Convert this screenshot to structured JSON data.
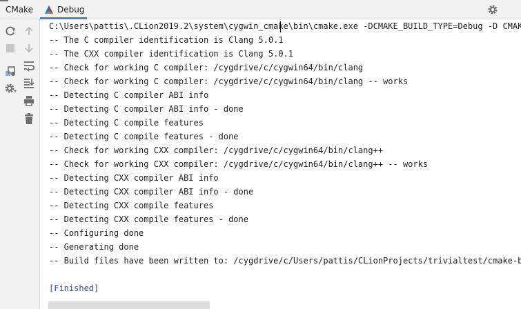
{
  "tabs": [
    {
      "label": "CMake"
    },
    {
      "label": "Debug"
    }
  ],
  "console": {
    "command": "C:\\Users\\pattis\\.CLion2019.2\\system\\cygwin_cmake\\bin\\cmake.exe -DCMAKE_BUILD_TYPE=Debug -D CMAKE_C",
    "lines": [
      "-- The C compiler identification is Clang 5.0.1",
      "-- The CXX compiler identification is Clang 5.0.1",
      "-- Check for working C compiler: /cygdrive/c/cygwin64/bin/clang",
      "-- Check for working C compiler: /cygdrive/c/cygwin64/bin/clang -- works",
      "-- Detecting C compiler ABI info",
      "-- Detecting C compiler ABI info - done",
      "-- Detecting C compile features",
      "-- Detecting C compile features - done",
      "-- Check for working CXX compiler: /cygdrive/c/cygwin64/bin/clang++",
      "-- Check for working CXX compiler: /cygdrive/c/cygwin64/bin/clang++ -- works",
      "-- Detecting CXX compiler ABI info",
      "-- Detecting CXX compiler ABI info - done",
      "-- Detecting CXX compile features",
      "-- Detecting CXX compile features - done",
      "-- Configuring done",
      "-- Generating done",
      "-- Build files have been written to: /cygdrive/c/Users/pattis/CLionProjects/trivialtest/cmake-buil"
    ],
    "finished": "[Finished]"
  },
  "icons": {
    "topbar": [
      "cmake-triangle-icon",
      "gear-icon",
      "minimize-icon"
    ],
    "leftbar": [
      "reload-icon",
      "stop-icon",
      "up-arrow-icon",
      "down-arrow-icon",
      "soft-wrap-icon",
      "cmake-settings-icon",
      "scroll-to-end-icon",
      "gear-icon",
      "print-icon",
      "trash-icon"
    ]
  },
  "colors": {
    "accent": "#4083c9",
    "finished": "#2b4fa0"
  }
}
